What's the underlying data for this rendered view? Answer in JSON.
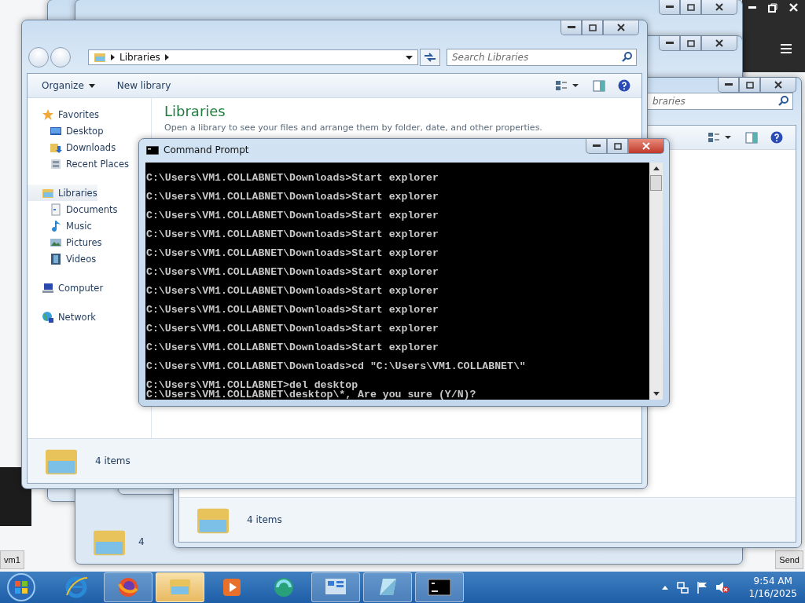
{
  "host": {
    "left_label": "vm1",
    "right_label": "Send"
  },
  "middle_window": {
    "status": "4"
  },
  "rear_explorer": {
    "search_placeholder": "braries",
    "status": "4 items"
  },
  "explorer": {
    "address": [
      "Libraries"
    ],
    "search_placeholder": "Search Libraries",
    "toolbar": [
      {
        "label": "Organize",
        "dropdown": true
      },
      {
        "label": "New library",
        "dropdown": false
      }
    ],
    "nav": [
      {
        "label": "Favorites",
        "kind": "star",
        "selected": false,
        "children": [
          {
            "label": "Desktop",
            "kind": "desktop",
            "selected": false
          },
          {
            "label": "Downloads",
            "kind": "downloads",
            "selected": false
          },
          {
            "label": "Recent Places",
            "kind": "recent",
            "selected": false
          }
        ]
      },
      {
        "label": "Libraries",
        "kind": "libraries",
        "selected": true,
        "children": [
          {
            "label": "Documents",
            "kind": "documents",
            "selected": false
          },
          {
            "label": "Music",
            "kind": "music",
            "selected": false
          },
          {
            "label": "Pictures",
            "kind": "pictures",
            "selected": false
          },
          {
            "label": "Videos",
            "kind": "videos",
            "selected": false
          }
        ]
      },
      {
        "label": "Computer",
        "kind": "computer",
        "selected": false
      },
      {
        "label": "Network",
        "kind": "network",
        "selected": false
      }
    ],
    "heading": "Libraries",
    "description": "Open a library to see your files and arrange them by folder, date, and other properties.",
    "status": "4 items"
  },
  "console": {
    "title": "Command Prompt",
    "lines": [
      {
        "text": "C:\\Users\\VM1.COLLABNET\\Downloads>Start explorer",
        "spaced": true
      },
      {
        "text": "C:\\Users\\VM1.COLLABNET\\Downloads>Start explorer",
        "spaced": true
      },
      {
        "text": "C:\\Users\\VM1.COLLABNET\\Downloads>Start explorer",
        "spaced": true
      },
      {
        "text": "C:\\Users\\VM1.COLLABNET\\Downloads>Start explorer",
        "spaced": true
      },
      {
        "text": "C:\\Users\\VM1.COLLABNET\\Downloads>Start explorer",
        "spaced": true
      },
      {
        "text": "C:\\Users\\VM1.COLLABNET\\Downloads>Start explorer",
        "spaced": true
      },
      {
        "text": "C:\\Users\\VM1.COLLABNET\\Downloads>Start explorer",
        "spaced": true
      },
      {
        "text": "C:\\Users\\VM1.COLLABNET\\Downloads>Start explorer",
        "spaced": true
      },
      {
        "text": "C:\\Users\\VM1.COLLABNET\\Downloads>Start explorer",
        "spaced": true
      },
      {
        "text": "C:\\Users\\VM1.COLLABNET\\Downloads>Start explorer",
        "spaced": true
      },
      {
        "text": "C:\\Users\\VM1.COLLABNET\\Downloads>cd \"C:\\Users\\VM1.COLLABNET\\\"",
        "spaced": true
      },
      {
        "text": "C:\\Users\\VM1.COLLABNET>del desktop",
        "spaced": true
      },
      {
        "text": "C:\\Users\\VM1.COLLABNET\\desktop\\*, Are you sure (Y/N)?",
        "spaced": false
      }
    ]
  },
  "taskbar": {
    "apps": [
      {
        "kind": "ie",
        "running": false,
        "selected": false
      },
      {
        "kind": "firefox",
        "running": true,
        "selected": false
      },
      {
        "kind": "explorer",
        "running": true,
        "selected": true
      },
      {
        "kind": "media",
        "running": false,
        "selected": false
      },
      {
        "kind": "globe",
        "running": false,
        "selected": false
      },
      {
        "kind": "control",
        "running": true,
        "selected": false
      },
      {
        "kind": "notepad",
        "running": true,
        "selected": false
      },
      {
        "kind": "console",
        "running": true,
        "selected": false
      }
    ],
    "time": "9:54 AM",
    "date": "1/16/2025"
  }
}
